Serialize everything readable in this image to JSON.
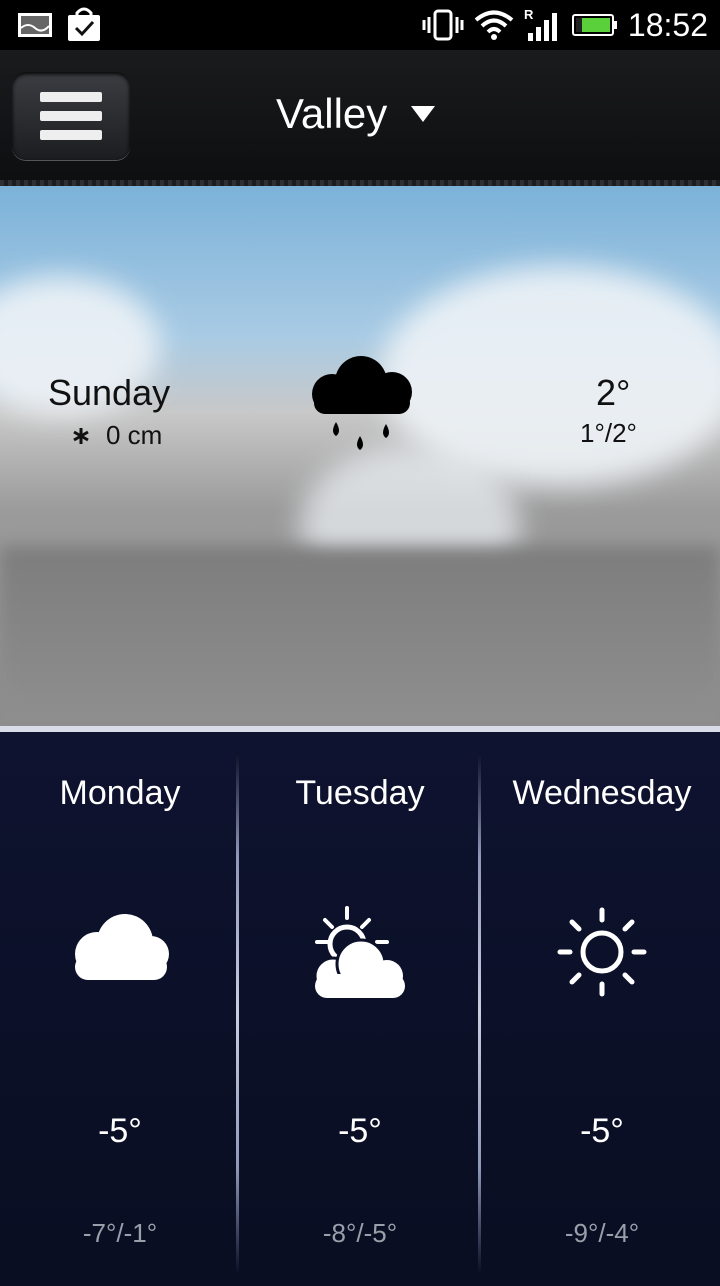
{
  "status_bar": {
    "time": "18:52",
    "left_icons": [
      "gallery-icon",
      "store-bag-icon"
    ],
    "right_icons": [
      "vibrate-icon",
      "wifi-icon",
      "signal-roaming-icon",
      "battery-icon"
    ]
  },
  "header": {
    "location": "Valley",
    "menu_icon": "hamburger-menu-icon",
    "dropdown_icon": "triangle-down-icon"
  },
  "today": {
    "day": "Sunday",
    "snow": "0 cm",
    "snow_icon": "snowflake-icon",
    "weather_icon": "rain-cloud-icon",
    "temp": "2°",
    "range": "1°/2°"
  },
  "forecast": [
    {
      "day": "Monday",
      "icon": "cloud-icon",
      "temp": "-5°",
      "range": "-7°/-1°"
    },
    {
      "day": "Tuesday",
      "icon": "partly-cloudy-icon",
      "temp": "-5°",
      "range": "-8°/-5°"
    },
    {
      "day": "Wednesday",
      "icon": "sun-icon",
      "temp": "-5°",
      "range": "-9°/-4°"
    }
  ],
  "colors": {
    "forecast_bg": "#0c1028",
    "today_text": "#111111",
    "range_text": "#9a9faa"
  }
}
